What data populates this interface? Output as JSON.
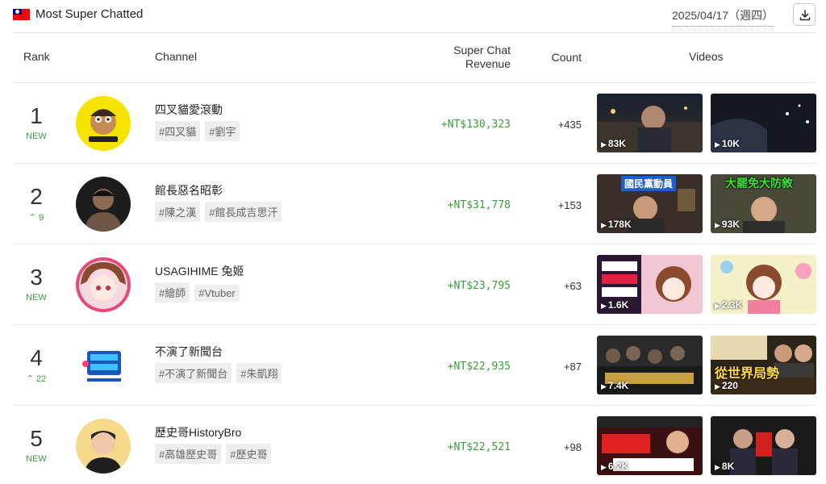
{
  "header": {
    "title": "Most Super Chatted",
    "date": "2025/04/17（週四）"
  },
  "columns": {
    "rank": "Rank",
    "channel": "Channel",
    "revenue_line1": "Super Chat",
    "revenue_line2": "Revenue",
    "count": "Count",
    "videos": "Videos"
  },
  "icons": {
    "flag": "taiwan-flag-icon",
    "download": "download-icon",
    "play": "play-icon",
    "up": "arrow-up-icon"
  },
  "colors": {
    "positive": "#3d9a3d"
  },
  "rows": [
    {
      "rank": "1",
      "change": "NEW",
      "name": "四叉貓愛滾動",
      "tags": [
        "#四叉貓",
        "#劉宇"
      ],
      "revenue": "+NT$130,323",
      "count": "+435",
      "videos": [
        {
          "views": "83K"
        },
        {
          "views": "10K"
        }
      ]
    },
    {
      "rank": "2",
      "change": "9",
      "name": "館長惡名昭彰",
      "tags": [
        "#陳之漢",
        "#館長成吉思汗"
      ],
      "revenue": "+NT$31,778",
      "count": "+153",
      "videos": [
        {
          "views": "178K",
          "caption": "國民黨動員"
        },
        {
          "views": "93K",
          "caption": "大罷免大防敘"
        }
      ]
    },
    {
      "rank": "3",
      "change": "NEW",
      "name": "USAGIHIME 兔姬",
      "tags": [
        "#繪師",
        "#Vtuber"
      ],
      "revenue": "+NT$23,795",
      "count": "+63",
      "videos": [
        {
          "views": "1.6K"
        },
        {
          "views": "2.3K"
        }
      ]
    },
    {
      "rank": "4",
      "change": "22",
      "name": "不演了新聞台",
      "tags": [
        "#不演了新聞台",
        "#朱凱翔"
      ],
      "revenue": "+NT$22,935",
      "count": "+87",
      "videos": [
        {
          "views": "7.4K"
        },
        {
          "views": "220",
          "caption": "從世界局勢"
        }
      ]
    },
    {
      "rank": "5",
      "change": "NEW",
      "name": "歷史哥HistoryBro",
      "tags": [
        "#高雄歷史哥",
        "#歷史哥"
      ],
      "revenue": "+NT$22,521",
      "count": "+98",
      "videos": [
        {
          "views": "6.2K"
        },
        {
          "views": "8K"
        }
      ]
    }
  ]
}
